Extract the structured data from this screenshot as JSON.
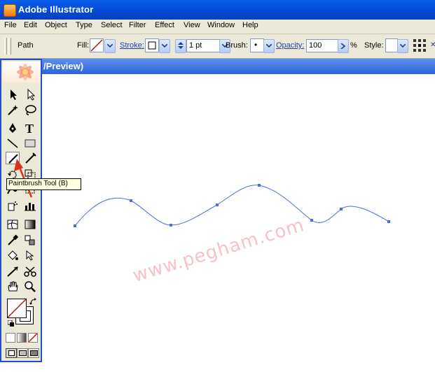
{
  "window": {
    "title": "Adobe Illustrator"
  },
  "menu": [
    "File",
    "Edit",
    "Object",
    "Type",
    "Select",
    "Filter",
    "Effect",
    "View",
    "Window",
    "Help"
  ],
  "control_bar": {
    "selection_label": "Path",
    "fill_label": "Fill:",
    "stroke_label": "Stroke:",
    "stroke_weight": "1 pt",
    "brush_label": "Brush:",
    "brush_value": "•",
    "opacity_label": "Opacity:",
    "opacity_value": "100",
    "percent": "%",
    "style_label": "Style:"
  },
  "document": {
    "title_fragment": "/Preview)"
  },
  "tooltip": {
    "text": "Paintbrush Tool (B)"
  },
  "watermark": "www.pegham.com",
  "colors": {
    "titlebar": "#0349d6",
    "path_stroke": "#4a6fd6",
    "anchor": "#4a6fd6",
    "arrow": "#e03018"
  },
  "tools_left": [
    "selection-arrow-icon",
    "magic-wand-icon",
    "pen-icon",
    "line-icon",
    "paintbrush-icon",
    "rotate-icon",
    "warp-icon",
    "symbol-sprayer-icon",
    "mesh-icon",
    "eyedropper-icon",
    "live-paint-icon",
    "slice-icon",
    "hand-icon"
  ],
  "tools_right": [
    "direct-selection-icon",
    "lasso-icon",
    "type-icon",
    "rectangle-icon",
    "pencil-icon",
    "scale-icon",
    "free-transform-icon",
    "column-graph-icon",
    "gradient-icon",
    "blend-icon",
    "live-paint-selection-icon",
    "scissors-icon",
    "zoom-icon"
  ]
}
